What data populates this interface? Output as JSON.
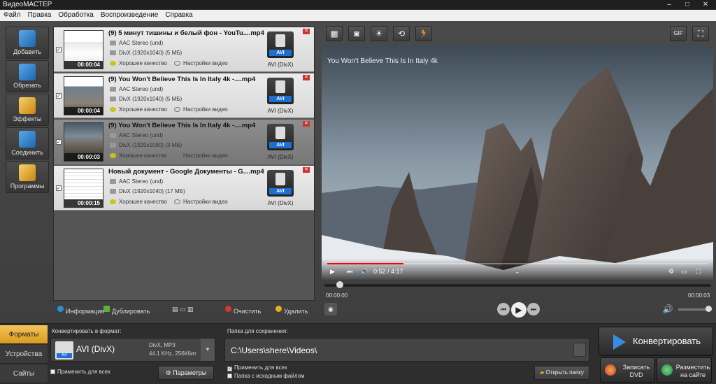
{
  "window": {
    "title": "ВидеоМАСТЕР",
    "controls": [
      "–",
      "□",
      "✕"
    ]
  },
  "menu": [
    "Файл",
    "Правка",
    "Обработка",
    "Воспроизведение",
    "Справка"
  ],
  "sidebar": {
    "items": [
      {
        "label": "Добавить",
        "icon": "add-film-icon",
        "color": "#2e8fd6"
      },
      {
        "label": "Обрезать",
        "icon": "cut-film-icon",
        "color": "#2e8fd6"
      },
      {
        "label": "Эффекты",
        "icon": "effects-wand-icon",
        "color": "#e0a21c"
      },
      {
        "label": "Соединить",
        "icon": "join-film-icon",
        "color": "#2e8fd6"
      },
      {
        "label": "Программы",
        "icon": "programs-icon",
        "color": "#e0a21c"
      }
    ]
  },
  "files": [
    {
      "checked": true,
      "title": "(9) 5 минут тишины и белый фон - YouTu....mp4",
      "audio": "AAC Stereo (und)",
      "video": "DivX (1920x1040) (5 МБ)",
      "quality": "Хорошее качество",
      "settings": "Настройки видео",
      "format": "AVI (DivX)",
      "badge": "AVI",
      "duration": "00:00:04",
      "selected": false,
      "thumb": "web"
    },
    {
      "checked": true,
      "title": "(9) You Won't Believe This Is In Italy 4k -....mp4",
      "audio": "AAC Stereo (und)",
      "video": "DivX (1920x1040) (5 МБ)",
      "quality": "Хорошее качество",
      "settings": "Настройки видео",
      "format": "AVI (DivX)",
      "badge": "AVI",
      "duration": "00:00:04",
      "selected": false,
      "thumb": "webmtn"
    },
    {
      "checked": true,
      "title": "(9) You Won't Believe This Is In Italy 4k -....mp4",
      "audio": "AAC Stereo (und)",
      "video": "DivX (1920x1080) (3 МБ)",
      "quality": "Хорошее качество",
      "settings": "Настройки видео",
      "format": "AVI (DivX)",
      "badge": "AVI",
      "duration": "00:00:03",
      "selected": true,
      "thumb": "mtn"
    },
    {
      "checked": true,
      "title": "Новый документ - Google Документы - G....mp4",
      "audio": "AAC Stereo (und)",
      "video": "DivX (1920x1040) (17 МБ)",
      "quality": "Хорошее качество",
      "settings": "Настройки видео",
      "format": "AVI (DivX)",
      "badge": "AVI",
      "duration": "00:00:15",
      "selected": false,
      "thumb": "doc"
    }
  ],
  "list_tools": {
    "info": "Информация",
    "duplicate": "Дублировать",
    "clear": "Очистить",
    "delete": "Удалить"
  },
  "player": {
    "video_title": "You Won't Believe This Is In Italy 4k",
    "embedded_time": "0:52 / 4:17",
    "embedded_progress": 0.2,
    "position": 0.03,
    "time_current": "00:00:00",
    "time_total": "00:00:03",
    "volume": 1.0
  },
  "format": {
    "tabs": [
      "Форматы",
      "Устройства",
      "Сайты"
    ],
    "active_tab": 0,
    "heading": "Конвертировать в формат:",
    "name": "AVI (DivX)",
    "badge": "AVI",
    "details": [
      "DivX, MP3",
      "44.1 KHz, 256Кбит"
    ],
    "apply_all": "Применить для всех",
    "params": "Параметры"
  },
  "save": {
    "heading": "Папка для сохранения:",
    "path": "C:\\Users\\shere\\Videos\\",
    "apply_all": "Применить для всех",
    "same_folder": "Папка с исходным файлом",
    "open_folder": "Открыть папку"
  },
  "actions": {
    "convert": "Конвертировать",
    "dvd": "Записать DVD",
    "site": "Разместить на сайте"
  },
  "colors": {
    "accent_tab": "#f0b93e",
    "avi_badge": "#1e6fd1",
    "progress_red": "#ff0000"
  }
}
